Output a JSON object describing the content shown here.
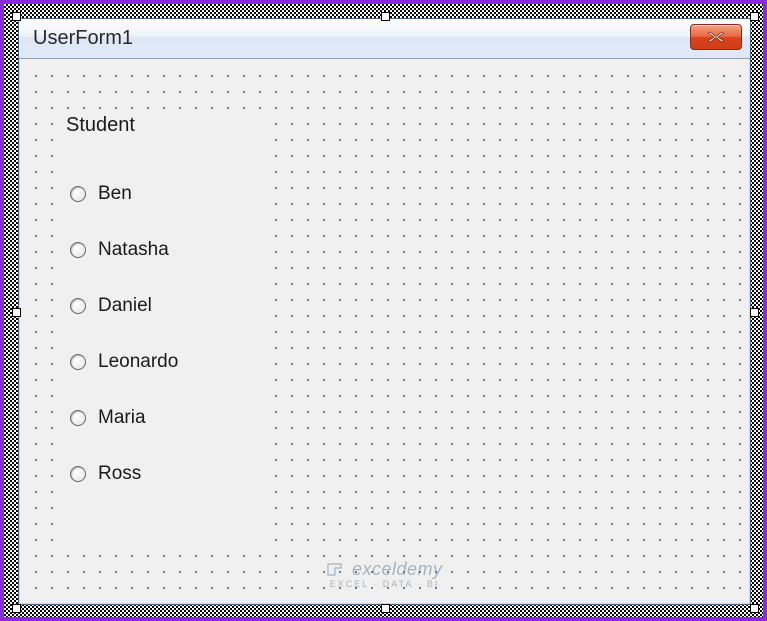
{
  "form": {
    "title": "UserForm1",
    "close_tooltip": "Close"
  },
  "frame": {
    "caption": "Student",
    "options": [
      {
        "label": "Ben"
      },
      {
        "label": "Natasha"
      },
      {
        "label": "Daniel"
      },
      {
        "label": "Leonardo"
      },
      {
        "label": "Maria"
      },
      {
        "label": "Ross"
      }
    ]
  },
  "watermark": {
    "brand": "exceldemy",
    "tagline": "EXCEL · DATA · BI"
  }
}
